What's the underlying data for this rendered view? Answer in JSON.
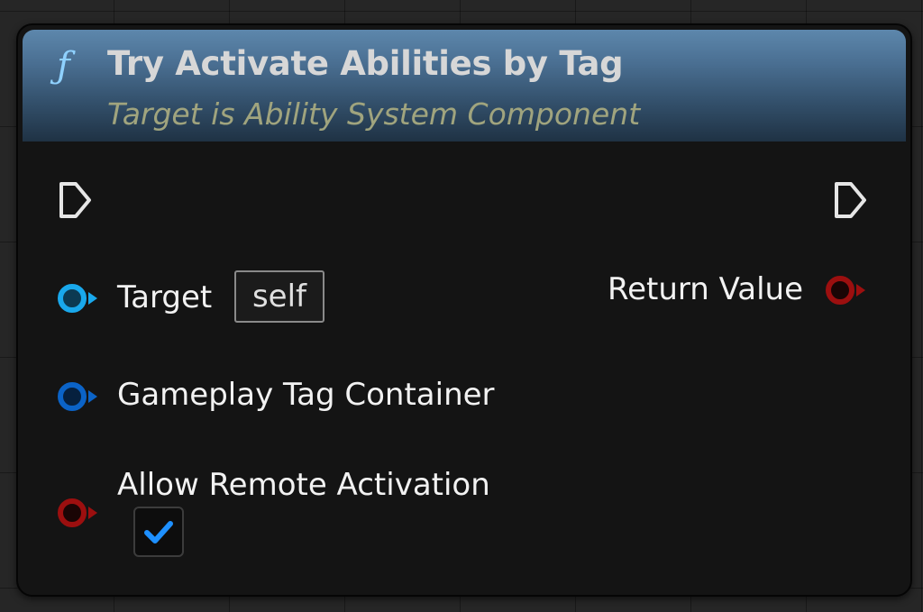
{
  "node": {
    "title": "Try Activate Abilities by Tag",
    "subtitle": "Target is Ability System Component",
    "icon": "function-icon"
  },
  "inputs": {
    "target": {
      "label": "Target",
      "default_value": "self",
      "pin_color": "#19a8ec"
    },
    "gameplay_tag_container": {
      "label": "Gameplay Tag Container",
      "pin_color": "#0b63c7"
    },
    "allow_remote_activation": {
      "label": "Allow Remote Activation",
      "checked": true,
      "pin_color": "#9c0f0f"
    }
  },
  "outputs": {
    "return_value": {
      "label": "Return Value",
      "pin_color": "#9c0f0f"
    }
  },
  "colors": {
    "header_accent": "#4a6f92",
    "checkmark": "#1e90ff",
    "exec_pin": "#e6e6e6"
  }
}
